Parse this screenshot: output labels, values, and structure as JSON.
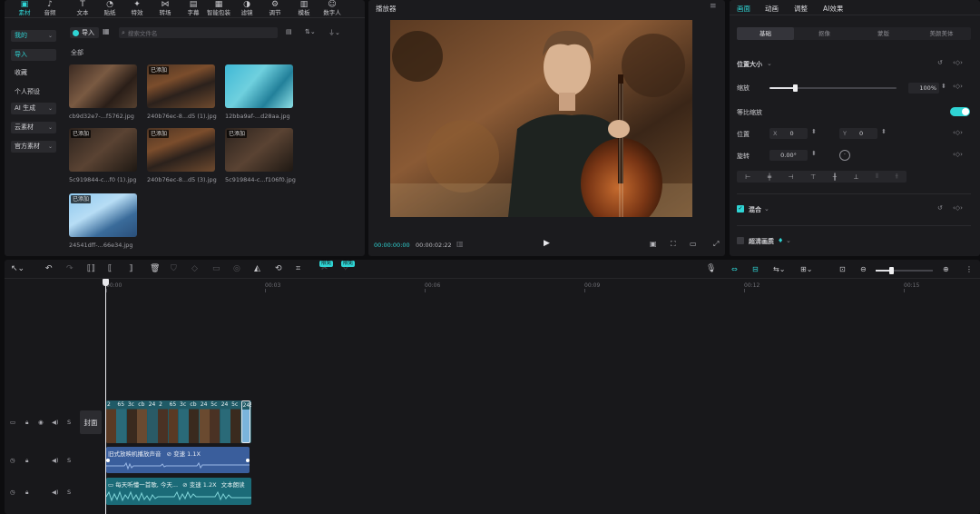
{
  "toolbar": {
    "items": [
      {
        "label": "素材",
        "icon": "media-icon"
      },
      {
        "label": "音频",
        "icon": "audio-icon"
      },
      {
        "label": "文本",
        "icon": "text-icon"
      },
      {
        "label": "贴纸",
        "icon": "sticker-icon"
      },
      {
        "label": "特效",
        "icon": "effects-icon"
      },
      {
        "label": "转场",
        "icon": "transition-icon"
      },
      {
        "label": "字幕",
        "icon": "subtitle-icon"
      },
      {
        "label": "智能包装",
        "icon": "smart-pack-icon"
      },
      {
        "label": "滤镜",
        "icon": "filter-icon"
      },
      {
        "label": "调节",
        "icon": "adjust-icon"
      },
      {
        "label": "模板",
        "icon": "template-icon"
      },
      {
        "label": "数字人",
        "icon": "digital-human-icon"
      }
    ]
  },
  "sidebar": {
    "items": [
      {
        "label": "我的",
        "chevron": "⌄"
      },
      {
        "label": "导入",
        "chevron": ""
      },
      {
        "label": "收藏",
        "chevron": ""
      },
      {
        "label": "个人预设",
        "chevron": ""
      },
      {
        "label": "AI 生成",
        "chevron": "⌄"
      },
      {
        "label": "云素材",
        "chevron": "⌄"
      },
      {
        "label": "官方素材",
        "chevron": "⌄"
      }
    ]
  },
  "media": {
    "import_label": "导入",
    "search_placeholder": "搜索文件名",
    "section_all": "全部",
    "added_tag": "已添加",
    "files": [
      "cb9d32e7-...f5762.jpg",
      "240b76ec-8...d5 (1).jpg",
      "12bba9af-...d28aa.jpg",
      "5c919844-c...f0 (1).jpg",
      "240b76ec-8...d5 (3).jpg",
      "5c919844-c...f106f0.jpg",
      "24541dff-...66e34.jpg"
    ]
  },
  "player": {
    "title": "播放器",
    "current_time": "00:00:00:00",
    "total_time": "00:00:02:22"
  },
  "inspector": {
    "tabs": [
      "画面",
      "动画",
      "调整",
      "AI效果"
    ],
    "subtabs": [
      "基础",
      "抠像",
      "蒙版",
      "美颜美体"
    ],
    "section_size": "位置大小",
    "scale_label": "缩放",
    "scale_value": "100%",
    "scale_percent": 40,
    "uniform_scale_label": "等比缩放",
    "position_label": "位置",
    "x_label": "X",
    "x_value": "0",
    "y_label": "Y",
    "y_value": "0",
    "rotation_label": "旋转",
    "rotation_value": "0.00°",
    "blend_label": "混合",
    "hd_label": "超清画质"
  },
  "timeline": {
    "ruler": [
      "00:00",
      "00:03",
      "00:06",
      "00:09",
      "00:12",
      "00:15"
    ],
    "cover_label": "封面",
    "badge_a": "限免",
    "badge_b": "限免",
    "audio1_name": "旧式放映机播放声音",
    "audio1_speed": "变速 1.1X",
    "audio2_name": "每天听懂一首歌, 今天...",
    "audio2_speed": "变速 1.2X",
    "audio2_extra": "文本朗读",
    "clip_labels": [
      "2",
      "65",
      "3c",
      "cb",
      "24",
      "2",
      "65",
      "3c",
      "cb",
      "24",
      "5c",
      "24",
      "5c",
      "2454"
    ],
    "track_s": "S"
  },
  "colors": {
    "accent": "#2fd4d4",
    "panel": "#1b1b1e",
    "audio_blue": "#3a5e9c",
    "audio_teal": "#1b6b78"
  }
}
